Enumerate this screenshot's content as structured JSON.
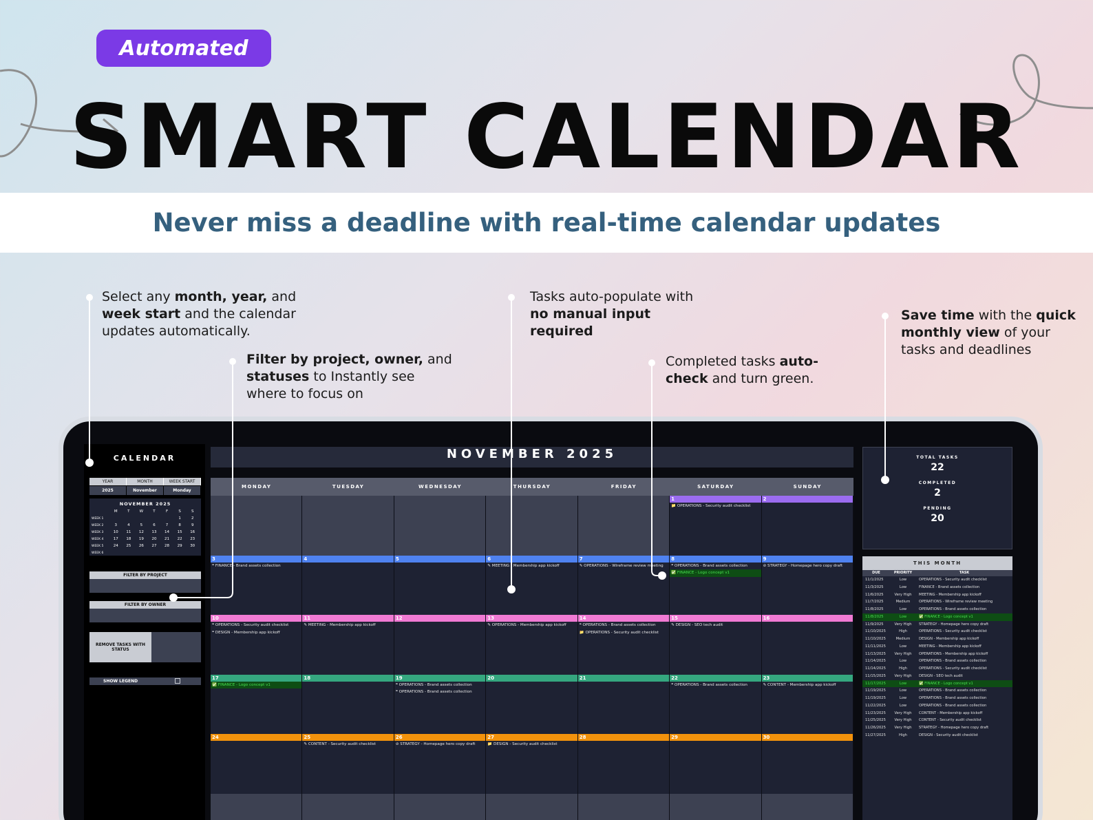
{
  "badge": "Automated",
  "title": "SMART CALENDAR",
  "subtitle": "Never miss a deadline with real-time calendar updates",
  "callouts": {
    "c1": {
      "a": "Select any ",
      "b": "month, year,",
      "c": " and ",
      "d": "week start",
      "e": " and the calendar updates automatically."
    },
    "c2": {
      "a": "Filter by project, owner,",
      "b": " and ",
      "c": "statuses",
      "d": " to Instantly see where to focus on"
    },
    "c3": {
      "a": "Tasks auto-populate with ",
      "b": "no manual input required"
    },
    "c4": {
      "a": "Completed tasks ",
      "b": "auto-check",
      "c": " and turn green."
    },
    "c5": {
      "a": "Save time",
      "b": " with the ",
      "c": "quick monthly view",
      "d": " of your tasks and deadlines"
    }
  },
  "sidebar": {
    "heading": "CALENDAR",
    "selectors": {
      "year_label": "YEAR",
      "month_label": "MONTH",
      "week_start_label": "WEEK START",
      "year": "2025",
      "month": "November",
      "week_start": "Monday"
    },
    "mini_title": "NOVEMBER 2025",
    "mini_days": [
      "M",
      "T",
      "W",
      "T",
      "F",
      "S",
      "S"
    ],
    "mini_weeks": [
      {
        "label": "WEEK 1",
        "days": [
          "",
          "",
          "",
          "",
          "",
          "1",
          "2"
        ]
      },
      {
        "label": "WEEK 2",
        "days": [
          "3",
          "4",
          "5",
          "6",
          "7",
          "8",
          "9"
        ]
      },
      {
        "label": "WEEK 3",
        "days": [
          "10",
          "11",
          "12",
          "13",
          "14",
          "15",
          "16"
        ]
      },
      {
        "label": "WEEK 4",
        "days": [
          "17",
          "18",
          "19",
          "20",
          "21",
          "22",
          "23"
        ]
      },
      {
        "label": "WEEK 5",
        "days": [
          "24",
          "25",
          "26",
          "27",
          "28",
          "29",
          "30"
        ]
      },
      {
        "label": "WEEK 6",
        "days": [
          "",
          "",
          "",
          "",
          "",
          "",
          ""
        ]
      }
    ],
    "filter_project": "FILTER BY PROJECT",
    "filter_owner": "FILTER BY OWNER",
    "remove_status": "REMOVE TASKS WITH STATUS",
    "show_legend": "SHOW LEGEND"
  },
  "calendar": {
    "month_title": "NOVEMBER 2025",
    "weekdays": [
      "MONDAY",
      "TUESDAY",
      "WEDNESDAY",
      "THURSDAY",
      "FRIDAY",
      "SATURDAY",
      "SUNDAY"
    ],
    "weeks": [
      {
        "color": "#9b6cf0",
        "days": [
          {
            "n": "",
            "tasks": []
          },
          {
            "n": "",
            "tasks": []
          },
          {
            "n": "",
            "tasks": []
          },
          {
            "n": "",
            "tasks": []
          },
          {
            "n": "",
            "tasks": []
          },
          {
            "n": "1",
            "tasks": [
              {
                "t": "📁 OPERATIONS - Security audit checklist",
                "done": false
              }
            ]
          },
          {
            "n": "2",
            "tasks": []
          }
        ]
      },
      {
        "color": "#4f82f0",
        "days": [
          {
            "n": "3",
            "tasks": [
              {
                "t": "❝ FINANCE - Brand assets collection",
                "done": false
              }
            ]
          },
          {
            "n": "4",
            "tasks": []
          },
          {
            "n": "5",
            "tasks": []
          },
          {
            "n": "6",
            "tasks": [
              {
                "t": "✎ MEETING - Membership app kickoff",
                "done": false
              }
            ]
          },
          {
            "n": "7",
            "tasks": [
              {
                "t": "✎ OPERATIONS - Wireframe review meeting",
                "done": false
              }
            ]
          },
          {
            "n": "8",
            "tasks": [
              {
                "t": "❝ OPERATIONS - Brand assets collection",
                "done": false
              },
              {
                "t": "✅ FINANCE - Logo concept v1",
                "done": true
              }
            ]
          },
          {
            "n": "9",
            "tasks": [
              {
                "t": "⊘ STRATEGY - Homepage hero copy draft",
                "done": false
              }
            ]
          }
        ]
      },
      {
        "color": "#f07ad3",
        "days": [
          {
            "n": "10",
            "tasks": [
              {
                "t": "❝ OPERATIONS - Security audit checklist",
                "done": false
              },
              {
                "t": "❝ DESIGN - Membership app kickoff",
                "done": false
              }
            ]
          },
          {
            "n": "11",
            "tasks": [
              {
                "t": "✎ MEETING - Membership app kickoff",
                "done": false
              }
            ]
          },
          {
            "n": "12",
            "tasks": []
          },
          {
            "n": "13",
            "tasks": [
              {
                "t": "✎ OPERATIONS - Membership app kickoff",
                "done": false
              }
            ]
          },
          {
            "n": "14",
            "tasks": [
              {
                "t": "❝ OPERATIONS - Brand assets collection",
                "done": false
              },
              {
                "t": "📁 OPERATIONS - Security audit checklist",
                "done": false
              }
            ]
          },
          {
            "n": "15",
            "tasks": [
              {
                "t": "✎ DESIGN - SEO tech audit",
                "done": false
              }
            ]
          },
          {
            "n": "16",
            "tasks": []
          }
        ]
      },
      {
        "color": "#35a77f",
        "days": [
          {
            "n": "17",
            "tasks": [
              {
                "t": "✅ FINANCE - Logo concept v1",
                "done": true
              }
            ]
          },
          {
            "n": "18",
            "tasks": []
          },
          {
            "n": "19",
            "tasks": [
              {
                "t": "❝ OPERATIONS - Brand assets collection",
                "done": false
              },
              {
                "t": "❝ OPERATIONS - Brand assets collection",
                "done": false
              }
            ]
          },
          {
            "n": "20",
            "tasks": []
          },
          {
            "n": "21",
            "tasks": []
          },
          {
            "n": "22",
            "tasks": [
              {
                "t": "❝ OPERATIONS - Brand assets collection",
                "done": false
              }
            ]
          },
          {
            "n": "23",
            "tasks": [
              {
                "t": "✎ CONTENT - Membership app kickoff",
                "done": false
              }
            ]
          }
        ]
      },
      {
        "color": "#f2920c",
        "days": [
          {
            "n": "24",
            "tasks": []
          },
          {
            "n": "25",
            "tasks": [
              {
                "t": "✎ CONTENT - Security audit checklist",
                "done": false
              }
            ]
          },
          {
            "n": "26",
            "tasks": [
              {
                "t": "⊘ STRATEGY - Homepage hero copy draft",
                "done": false
              }
            ]
          },
          {
            "n": "27",
            "tasks": [
              {
                "t": "📁 DESIGN - Security audit checklist",
                "done": false
              }
            ]
          },
          {
            "n": "28",
            "tasks": []
          },
          {
            "n": "29",
            "tasks": []
          },
          {
            "n": "30",
            "tasks": []
          }
        ]
      }
    ]
  },
  "stats": {
    "total_label": "TOTAL TASKS",
    "total": "22",
    "completed_label": "COMPLETED",
    "completed": "2",
    "pending_label": "PENDING",
    "pending": "20"
  },
  "this_month": {
    "title": "THIS MONTH",
    "cols": [
      "DUE",
      "PRIORITY",
      "TASK"
    ],
    "rows": [
      {
        "d": "11/1/2025",
        "p": "Low",
        "t": "OPERATIONS - Security audit checklist",
        "done": false
      },
      {
        "d": "11/3/2025",
        "p": "Low",
        "t": "FINANCE - Brand assets collection",
        "done": false
      },
      {
        "d": "11/6/2025",
        "p": "Very High",
        "t": "MEETING - Membership app kickoff",
        "done": false
      },
      {
        "d": "11/7/2025",
        "p": "Medium",
        "t": "OPERATIONS - Wireframe review meeting",
        "done": false
      },
      {
        "d": "11/8/2025",
        "p": "Low",
        "t": "OPERATIONS - Brand assets collection",
        "done": false
      },
      {
        "d": "11/8/2025",
        "p": "Low",
        "t": "✅ FINANCE - Logo concept v1",
        "done": true
      },
      {
        "d": "11/9/2025",
        "p": "Very High",
        "t": "STRATEGY - Homepage hero copy draft",
        "done": false
      },
      {
        "d": "11/10/2025",
        "p": "High",
        "t": "OPERATIONS - Security audit checklist",
        "done": false
      },
      {
        "d": "11/10/2025",
        "p": "Medium",
        "t": "DESIGN - Membership app kickoff",
        "done": false
      },
      {
        "d": "11/11/2025",
        "p": "Low",
        "t": "MEETING - Membership app kickoff",
        "done": false
      },
      {
        "d": "11/13/2025",
        "p": "Very High",
        "t": "OPERATIONS - Membership app kickoff",
        "done": false
      },
      {
        "d": "11/14/2025",
        "p": "Low",
        "t": "OPERATIONS - Brand assets collection",
        "done": false
      },
      {
        "d": "11/14/2025",
        "p": "High",
        "t": "OPERATIONS - Security audit checklist",
        "done": false
      },
      {
        "d": "11/15/2025",
        "p": "Very High",
        "t": "DESIGN - SEO tech audit",
        "done": false
      },
      {
        "d": "11/17/2025",
        "p": "Low",
        "t": "✅ FINANCE - Logo concept v1",
        "done": true
      },
      {
        "d": "11/19/2025",
        "p": "Low",
        "t": "OPERATIONS - Brand assets collection",
        "done": false
      },
      {
        "d": "11/19/2025",
        "p": "Low",
        "t": "OPERATIONS - Brand assets collection",
        "done": false
      },
      {
        "d": "11/22/2025",
        "p": "Low",
        "t": "OPERATIONS - Brand assets collection",
        "done": false
      },
      {
        "d": "11/23/2025",
        "p": "Very High",
        "t": "CONTENT - Membership app kickoff",
        "done": false
      },
      {
        "d": "11/25/2025",
        "p": "Very High",
        "t": "CONTENT - Security audit checklist",
        "done": false
      },
      {
        "d": "11/26/2025",
        "p": "Very High",
        "t": "STRATEGY - Homepage hero copy draft",
        "done": false
      },
      {
        "d": "11/27/2025",
        "p": "High",
        "t": "DESIGN - Security audit checklist",
        "done": false
      }
    ]
  }
}
